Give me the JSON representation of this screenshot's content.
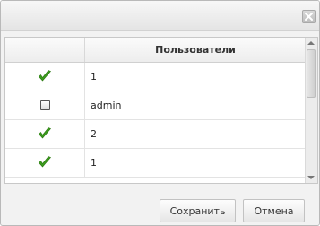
{
  "dialog": {
    "close_icon": "close-icon"
  },
  "grid": {
    "columns": [
      "",
      "Пользователи"
    ],
    "rows": [
      {
        "checked": true,
        "name": "1"
      },
      {
        "checked": false,
        "name": "admin"
      },
      {
        "checked": true,
        "name": "2"
      },
      {
        "checked": true,
        "name": "1"
      }
    ]
  },
  "footer": {
    "save_label": "Сохранить",
    "cancel_label": "Отмена"
  },
  "colors": {
    "check_green": "#3a9a1c",
    "check_light": "#7fd14f"
  }
}
